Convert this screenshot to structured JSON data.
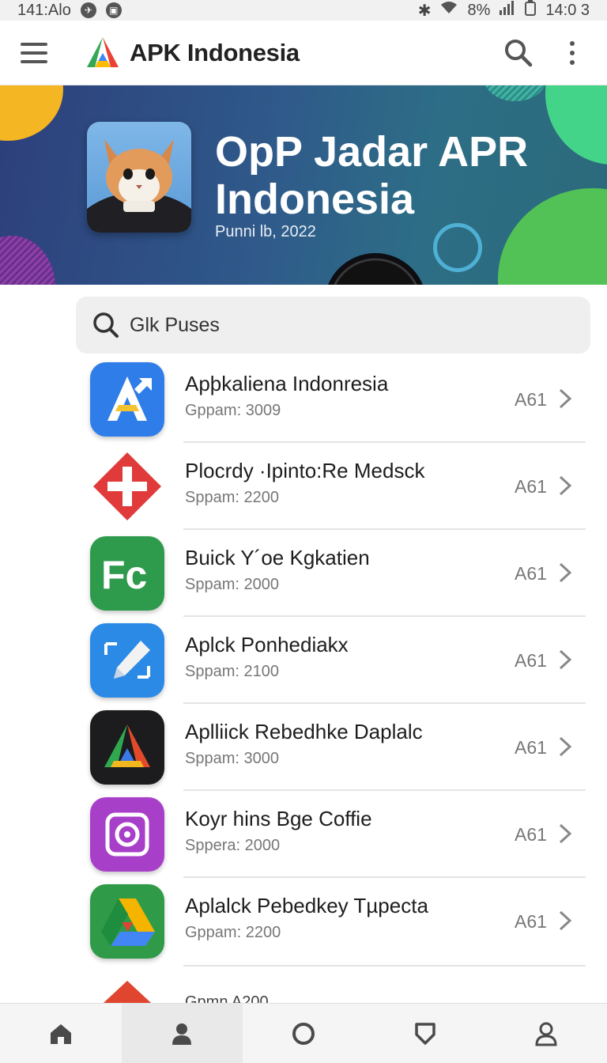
{
  "status_bar": {
    "time": "141:Alo",
    "right_text": "8%",
    "clock_right": "14:0 3"
  },
  "app_bar": {
    "title": "APK Indonesia"
  },
  "banner": {
    "title": "OpP Jadar APR Indonesia",
    "subtitle": "Punni lb, 2022"
  },
  "search": {
    "placeholder": "Glk Puses"
  },
  "apps": [
    {
      "name": "Apþkaliena Indonresia",
      "meta": "Gppam: 3009",
      "badge": "A61",
      "icon": "a-arrow-icon"
    },
    {
      "name": "Plocrdy ·Ipinto:Re Medsck",
      "meta": "Sppam: 2200",
      "badge": "A61",
      "icon": "red-cross-icon"
    },
    {
      "name": "Buick Y´oe Kgkatien",
      "meta": "Sppam: 2000",
      "badge": "A61",
      "icon": "fc-icon"
    },
    {
      "name": "Aplck Ponhediakx",
      "meta": "Sppam: 2100",
      "badge": "A61",
      "icon": "pen-edit-icon"
    },
    {
      "name": "Aplliick Rebedhke Daplalc",
      "meta": "Sppam: 3000",
      "badge": "A61",
      "icon": "triangle-logo-icon"
    },
    {
      "name": "Koyr hins Bge Coffie",
      "meta": "Sppera: 2000",
      "badge": "A61",
      "icon": "target-icon"
    },
    {
      "name": "Aplalck Pebedkey Tµpecta",
      "meta": "Gppam: 2200",
      "badge": "A61",
      "icon": "drive-icon"
    },
    {
      "name": "",
      "meta": "Gpmn A200",
      "badge": "",
      "icon": "red-partial-icon"
    }
  ],
  "bottom_nav": [
    {
      "id": "home",
      "icon": "home-icon"
    },
    {
      "id": "account",
      "icon": "person-filled-icon"
    },
    {
      "id": "circle",
      "icon": "circle-icon"
    },
    {
      "id": "shield",
      "icon": "shield-icon"
    },
    {
      "id": "profile",
      "icon": "profile-outline-icon"
    }
  ]
}
